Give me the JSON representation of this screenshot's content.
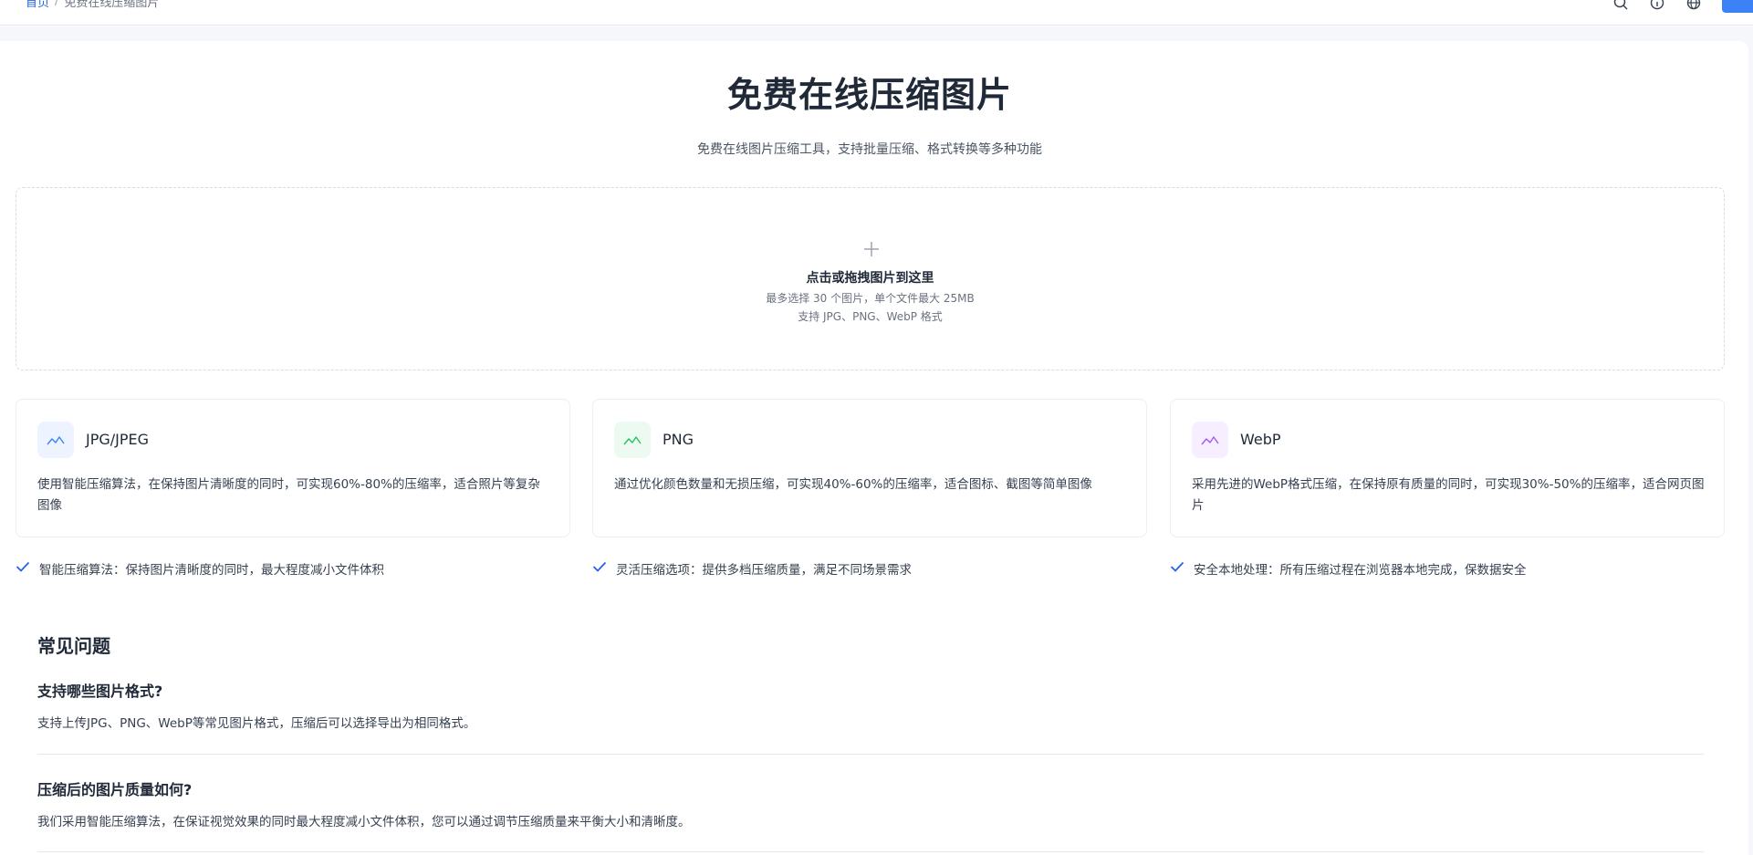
{
  "header": {
    "breadcrumb": {
      "home": "首页",
      "separator": "/",
      "current": "免费在线压缩图片"
    },
    "icons": [
      "search-icon",
      "info-icon",
      "globe-icon"
    ]
  },
  "main": {
    "title": "免费在线压缩图片",
    "subtitle": "免费在线图片压缩工具，支持批量压缩、格式转换等多种功能",
    "upload": {
      "title": "点击或拖拽图片到这里",
      "limit_note": "最多选择 30 个图片，单个文件最大 25MB",
      "format_note": "支持 JPG、PNG、WebP 格式"
    },
    "formats": [
      {
        "name": "JPG/JPEG",
        "description": "使用智能压缩算法，在保持图片清晰度的同时，可实现60%-80%的压缩率，适合照片等复杂图像",
        "color": "#3b82f6",
        "bg": "#eef4ff"
      },
      {
        "name": "PNG",
        "description": "通过优化颜色数量和无损压缩，可实现40%-60%的压缩率，适合图标、截图等简单图像",
        "color": "#22c55e",
        "bg": "#ecfaf1"
      },
      {
        "name": "WebP",
        "description": "采用先进的WebP格式压缩，在保持原有质量的同时，可实现30%-50%的压缩率，适合网页图片",
        "color": "#a855f7",
        "bg": "#f7efff"
      }
    ],
    "features": [
      {
        "label": "智能压缩算法：保持图片清晰度的同时，最大程度减小文件体积"
      },
      {
        "label": "灵活压缩选项：提供多档压缩质量，满足不同场景需求"
      },
      {
        "label": "安全本地处理：所有压缩过程在浏览器本地完成，保数据安全"
      }
    ],
    "accent_color": "#2563eb"
  },
  "faq": {
    "heading": "常见问题",
    "items": [
      {
        "question": "支持哪些图片格式?",
        "answer": "支持上传JPG、PNG、WebP等常见图片格式，压缩后可以选择导出为相同格式。"
      },
      {
        "question": "压缩后的图片质量如何?",
        "answer": "我们采用智能压缩算法，在保证视觉效果的同时最大程度减小文件体积，您可以通过调节压缩质量来平衡大小和清晰度。"
      }
    ]
  }
}
